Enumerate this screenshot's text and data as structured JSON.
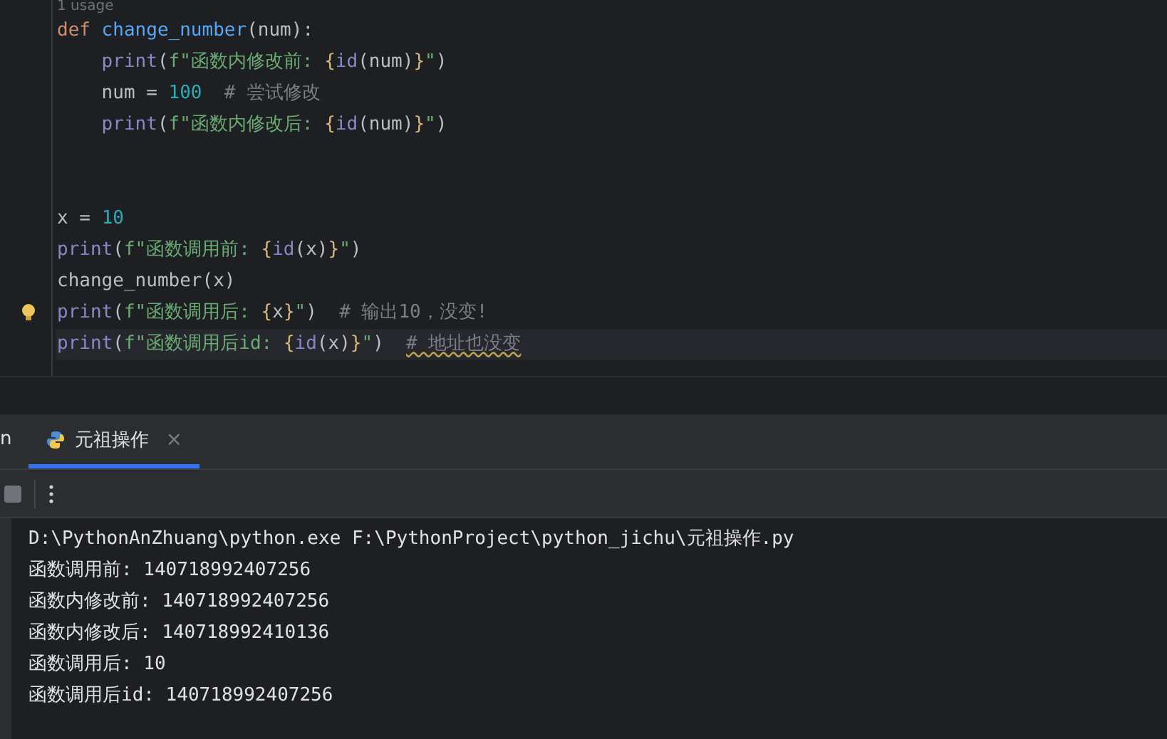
{
  "editor": {
    "usage_hint": "1 usage",
    "lines": [
      {
        "current": false,
        "bulb": false,
        "indented": false,
        "tokens": [
          {
            "t": "def",
            "kind": "keyword"
          },
          {
            "t": " change_number",
            "kind": "function"
          },
          {
            "t": "(num):",
            "kind": "plain"
          }
        ]
      },
      {
        "current": false,
        "bulb": false,
        "indented": true,
        "tokens": [
          {
            "t": "print",
            "kind": "builtin"
          },
          {
            "t": "(",
            "kind": "plain"
          },
          {
            "t": "f\"函数内修改前: ",
            "kind": "string"
          },
          {
            "t": "{",
            "kind": "brace"
          },
          {
            "t": "id",
            "kind": "builtin"
          },
          {
            "t": "(num)",
            "kind": "plain"
          },
          {
            "t": "}",
            "kind": "brace"
          },
          {
            "t": "\"",
            "kind": "string"
          },
          {
            "t": ")",
            "kind": "plain"
          }
        ]
      },
      {
        "current": false,
        "bulb": false,
        "indented": true,
        "tokens": [
          {
            "t": "num = ",
            "kind": "plain"
          },
          {
            "t": "100",
            "kind": "number"
          },
          {
            "t": "  # 尝试修改",
            "kind": "comment"
          }
        ]
      },
      {
        "current": false,
        "bulb": false,
        "indented": true,
        "tokens": [
          {
            "t": "print",
            "kind": "builtin"
          },
          {
            "t": "(",
            "kind": "plain"
          },
          {
            "t": "f\"函数内修改后: ",
            "kind": "string"
          },
          {
            "t": "{",
            "kind": "brace"
          },
          {
            "t": "id",
            "kind": "builtin"
          },
          {
            "t": "(num)",
            "kind": "plain"
          },
          {
            "t": "}",
            "kind": "brace"
          },
          {
            "t": "\"",
            "kind": "string"
          },
          {
            "t": ")",
            "kind": "plain"
          }
        ]
      },
      {
        "current": false,
        "bulb": false
      },
      {
        "current": false,
        "bulb": false
      },
      {
        "current": false,
        "bulb": false,
        "indented": false,
        "tokens": [
          {
            "t": "x = ",
            "kind": "plain"
          },
          {
            "t": "10",
            "kind": "number"
          }
        ]
      },
      {
        "current": false,
        "bulb": false,
        "indented": false,
        "tokens": [
          {
            "t": "print",
            "kind": "builtin"
          },
          {
            "t": "(",
            "kind": "plain"
          },
          {
            "t": "f\"函数调用前: ",
            "kind": "string"
          },
          {
            "t": "{",
            "kind": "brace"
          },
          {
            "t": "id",
            "kind": "builtin"
          },
          {
            "t": "(x)",
            "kind": "plain"
          },
          {
            "t": "}",
            "kind": "brace"
          },
          {
            "t": "\"",
            "kind": "string"
          },
          {
            "t": ")",
            "kind": "plain"
          }
        ]
      },
      {
        "current": false,
        "bulb": false,
        "indented": false,
        "tokens": [
          {
            "t": "change_number(x)",
            "kind": "plain"
          }
        ]
      },
      {
        "current": false,
        "bulb": true,
        "indented": false,
        "tokens": [
          {
            "t": "print",
            "kind": "builtin"
          },
          {
            "t": "(",
            "kind": "plain"
          },
          {
            "t": "f\"函数调用后: ",
            "kind": "string"
          },
          {
            "t": "{",
            "kind": "brace"
          },
          {
            "t": "x",
            "kind": "plain"
          },
          {
            "t": "}",
            "kind": "brace"
          },
          {
            "t": "\"",
            "kind": "string"
          },
          {
            "t": ")",
            "kind": "plain"
          },
          {
            "t": "  # 输出10，没变!",
            "kind": "comment"
          }
        ]
      },
      {
        "current": true,
        "bulb": false,
        "indented": false,
        "tokens": [
          {
            "t": "print",
            "kind": "builtin"
          },
          {
            "t": "(",
            "kind": "plain"
          },
          {
            "t": "f\"函数调用后id: ",
            "kind": "string"
          },
          {
            "t": "{",
            "kind": "brace"
          },
          {
            "t": "id",
            "kind": "builtin"
          },
          {
            "t": "(x)",
            "kind": "plain"
          },
          {
            "t": "}",
            "kind": "brace"
          },
          {
            "t": "\"",
            "kind": "string"
          },
          {
            "t": ")",
            "kind": "plain"
          },
          {
            "t": "# 地址也没变",
            "kind": "misspelled_comment"
          }
        ]
      }
    ]
  },
  "run_panel": {
    "tabs": [
      {
        "label": "n",
        "selected": false,
        "python_icon": false,
        "closable": false
      },
      {
        "label": "元祖操作",
        "selected": true,
        "python_icon": true,
        "closable": true
      }
    ],
    "close_glyph": "×",
    "console": [
      "D:\\PythonAnZhuang\\python.exe F:\\PythonProject\\python_jichu\\元祖操作.py",
      "函数调用前: 140718992407256",
      "函数内修改前: 140718992407256",
      "函数内修改后: 140718992410136",
      "函数调用后: 10",
      "函数调用后id: 140718992407256"
    ]
  }
}
